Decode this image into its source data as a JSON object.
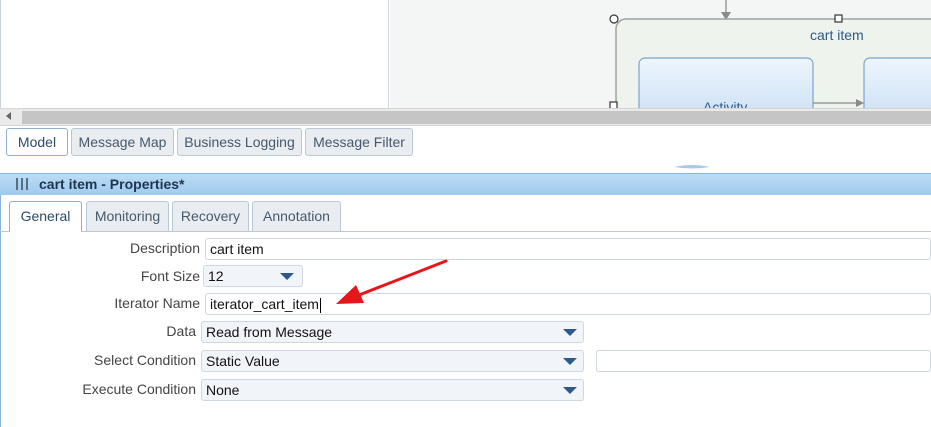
{
  "canvas": {
    "group_label": "cart item",
    "activity_label": "Activity"
  },
  "model_tabs": [
    {
      "label": "Model"
    },
    {
      "label": "Message Map"
    },
    {
      "label": "Business Logging"
    },
    {
      "label": "Message Filter"
    }
  ],
  "properties": {
    "title": "cart item - Properties*",
    "tabs": [
      {
        "label": "General"
      },
      {
        "label": "Monitoring"
      },
      {
        "label": "Recovery"
      },
      {
        "label": "Annotation"
      }
    ],
    "fields": {
      "description": {
        "label": "Description",
        "value": "cart item"
      },
      "font_size": {
        "label": "Font Size",
        "value": "12"
      },
      "iterator_name": {
        "label": "Iterator Name",
        "value": "iterator_cart_item"
      },
      "data": {
        "label": "Data",
        "value": "Read from Message"
      },
      "select_condition": {
        "label": "Select Condition",
        "value": "Static Value",
        "extra_value": ""
      },
      "execute_condition": {
        "label": "Execute Condition",
        "value": "None"
      }
    }
  },
  "colors": {
    "annotation_arrow": "#e8161b",
    "header_bar": "#a8d0f0",
    "dropdown_arrow": "#2d5a86"
  }
}
